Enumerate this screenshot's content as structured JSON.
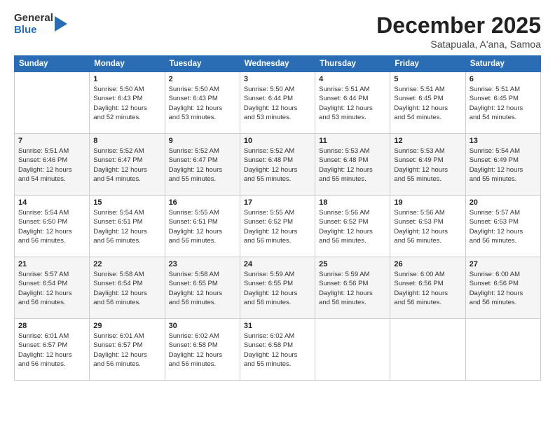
{
  "logo": {
    "general": "General",
    "blue": "Blue"
  },
  "header": {
    "title": "December 2025",
    "subtitle": "Satapuala, A'ana, Samoa"
  },
  "weekdays": [
    "Sunday",
    "Monday",
    "Tuesday",
    "Wednesday",
    "Thursday",
    "Friday",
    "Saturday"
  ],
  "weeks": [
    [
      {
        "day": "",
        "info": ""
      },
      {
        "day": "1",
        "info": "Sunrise: 5:50 AM\nSunset: 6:43 PM\nDaylight: 12 hours\nand 52 minutes."
      },
      {
        "day": "2",
        "info": "Sunrise: 5:50 AM\nSunset: 6:43 PM\nDaylight: 12 hours\nand 53 minutes."
      },
      {
        "day": "3",
        "info": "Sunrise: 5:50 AM\nSunset: 6:44 PM\nDaylight: 12 hours\nand 53 minutes."
      },
      {
        "day": "4",
        "info": "Sunrise: 5:51 AM\nSunset: 6:44 PM\nDaylight: 12 hours\nand 53 minutes."
      },
      {
        "day": "5",
        "info": "Sunrise: 5:51 AM\nSunset: 6:45 PM\nDaylight: 12 hours\nand 54 minutes."
      },
      {
        "day": "6",
        "info": "Sunrise: 5:51 AM\nSunset: 6:45 PM\nDaylight: 12 hours\nand 54 minutes."
      }
    ],
    [
      {
        "day": "7",
        "info": "Sunrise: 5:51 AM\nSunset: 6:46 PM\nDaylight: 12 hours\nand 54 minutes."
      },
      {
        "day": "8",
        "info": "Sunrise: 5:52 AM\nSunset: 6:47 PM\nDaylight: 12 hours\nand 54 minutes."
      },
      {
        "day": "9",
        "info": "Sunrise: 5:52 AM\nSunset: 6:47 PM\nDaylight: 12 hours\nand 55 minutes."
      },
      {
        "day": "10",
        "info": "Sunrise: 5:52 AM\nSunset: 6:48 PM\nDaylight: 12 hours\nand 55 minutes."
      },
      {
        "day": "11",
        "info": "Sunrise: 5:53 AM\nSunset: 6:48 PM\nDaylight: 12 hours\nand 55 minutes."
      },
      {
        "day": "12",
        "info": "Sunrise: 5:53 AM\nSunset: 6:49 PM\nDaylight: 12 hours\nand 55 minutes."
      },
      {
        "day": "13",
        "info": "Sunrise: 5:54 AM\nSunset: 6:49 PM\nDaylight: 12 hours\nand 55 minutes."
      }
    ],
    [
      {
        "day": "14",
        "info": "Sunrise: 5:54 AM\nSunset: 6:50 PM\nDaylight: 12 hours\nand 56 minutes."
      },
      {
        "day": "15",
        "info": "Sunrise: 5:54 AM\nSunset: 6:51 PM\nDaylight: 12 hours\nand 56 minutes."
      },
      {
        "day": "16",
        "info": "Sunrise: 5:55 AM\nSunset: 6:51 PM\nDaylight: 12 hours\nand 56 minutes."
      },
      {
        "day": "17",
        "info": "Sunrise: 5:55 AM\nSunset: 6:52 PM\nDaylight: 12 hours\nand 56 minutes."
      },
      {
        "day": "18",
        "info": "Sunrise: 5:56 AM\nSunset: 6:52 PM\nDaylight: 12 hours\nand 56 minutes."
      },
      {
        "day": "19",
        "info": "Sunrise: 5:56 AM\nSunset: 6:53 PM\nDaylight: 12 hours\nand 56 minutes."
      },
      {
        "day": "20",
        "info": "Sunrise: 5:57 AM\nSunset: 6:53 PM\nDaylight: 12 hours\nand 56 minutes."
      }
    ],
    [
      {
        "day": "21",
        "info": "Sunrise: 5:57 AM\nSunset: 6:54 PM\nDaylight: 12 hours\nand 56 minutes."
      },
      {
        "day": "22",
        "info": "Sunrise: 5:58 AM\nSunset: 6:54 PM\nDaylight: 12 hours\nand 56 minutes."
      },
      {
        "day": "23",
        "info": "Sunrise: 5:58 AM\nSunset: 6:55 PM\nDaylight: 12 hours\nand 56 minutes."
      },
      {
        "day": "24",
        "info": "Sunrise: 5:59 AM\nSunset: 6:55 PM\nDaylight: 12 hours\nand 56 minutes."
      },
      {
        "day": "25",
        "info": "Sunrise: 5:59 AM\nSunset: 6:56 PM\nDaylight: 12 hours\nand 56 minutes."
      },
      {
        "day": "26",
        "info": "Sunrise: 6:00 AM\nSunset: 6:56 PM\nDaylight: 12 hours\nand 56 minutes."
      },
      {
        "day": "27",
        "info": "Sunrise: 6:00 AM\nSunset: 6:56 PM\nDaylight: 12 hours\nand 56 minutes."
      }
    ],
    [
      {
        "day": "28",
        "info": "Sunrise: 6:01 AM\nSunset: 6:57 PM\nDaylight: 12 hours\nand 56 minutes."
      },
      {
        "day": "29",
        "info": "Sunrise: 6:01 AM\nSunset: 6:57 PM\nDaylight: 12 hours\nand 56 minutes."
      },
      {
        "day": "30",
        "info": "Sunrise: 6:02 AM\nSunset: 6:58 PM\nDaylight: 12 hours\nand 56 minutes."
      },
      {
        "day": "31",
        "info": "Sunrise: 6:02 AM\nSunset: 6:58 PM\nDaylight: 12 hours\nand 55 minutes."
      },
      {
        "day": "",
        "info": ""
      },
      {
        "day": "",
        "info": ""
      },
      {
        "day": "",
        "info": ""
      }
    ]
  ]
}
